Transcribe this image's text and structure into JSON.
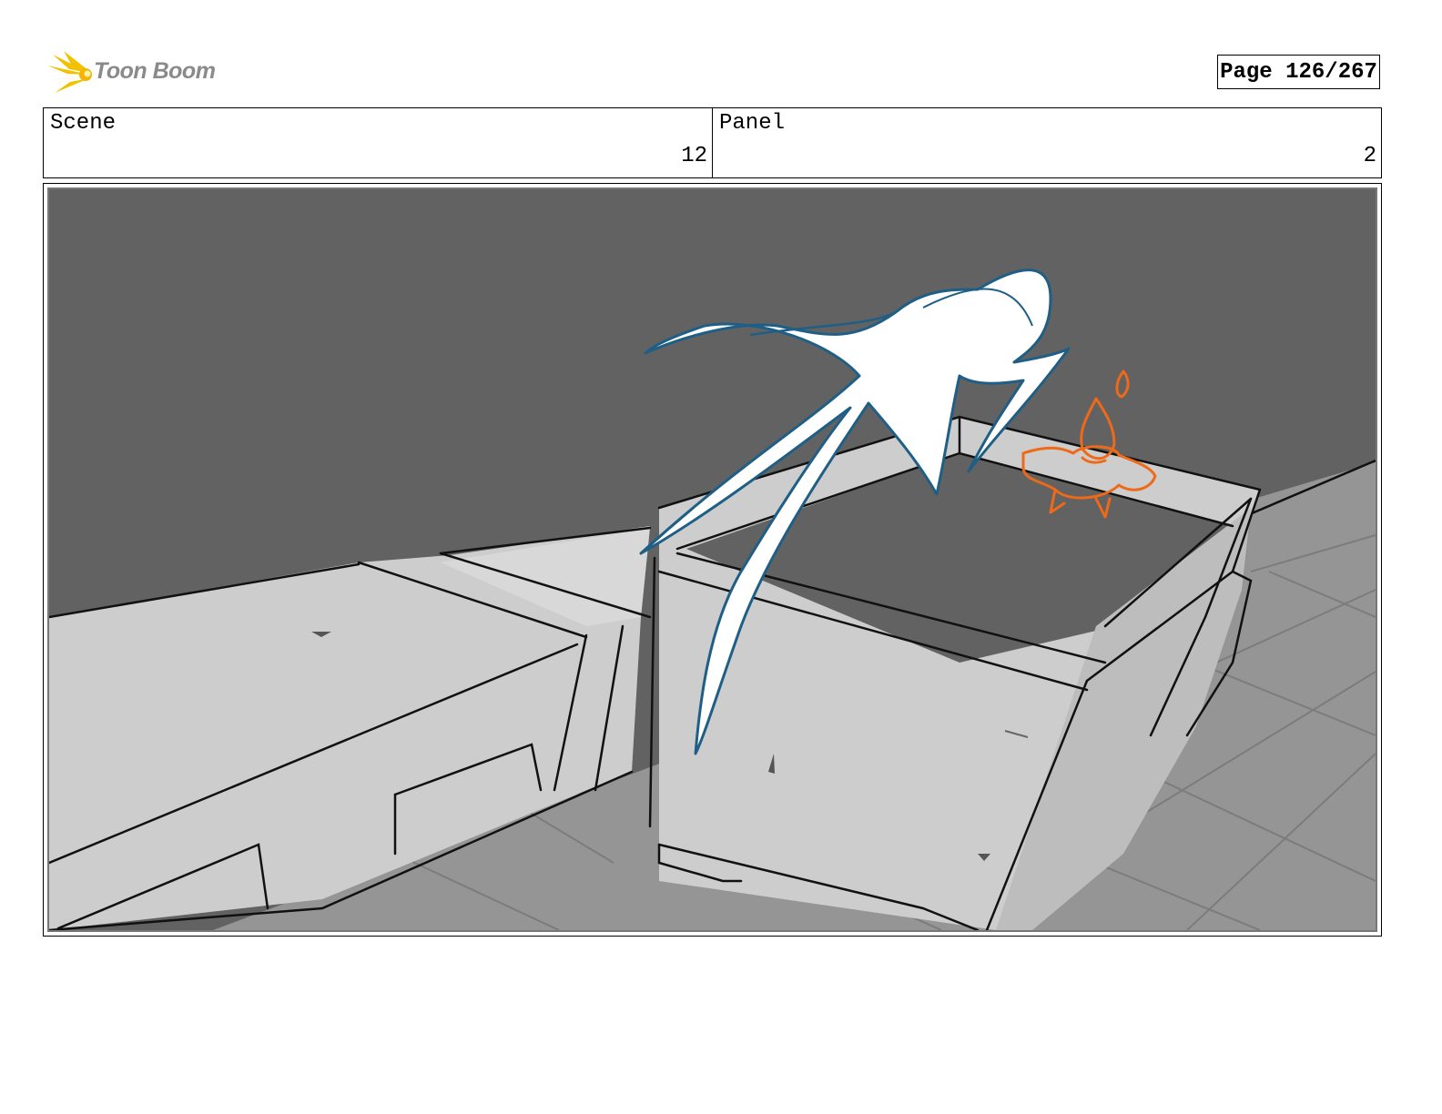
{
  "header": {
    "brand": "Toon Boom",
    "page_label": "Page 126/267"
  },
  "info": {
    "scene_label": "Scene",
    "scene_value": "12",
    "panel_label": "Panel",
    "panel_value": "2"
  },
  "panel": {
    "content_icon": "storyboard-sketch",
    "colors": {
      "background_gray": "#626262",
      "light_gray": "#cdcdcd",
      "floor_gray": "#959595",
      "creature_outline": "#1f5f86",
      "flame_outline": "#ee6a18"
    }
  }
}
